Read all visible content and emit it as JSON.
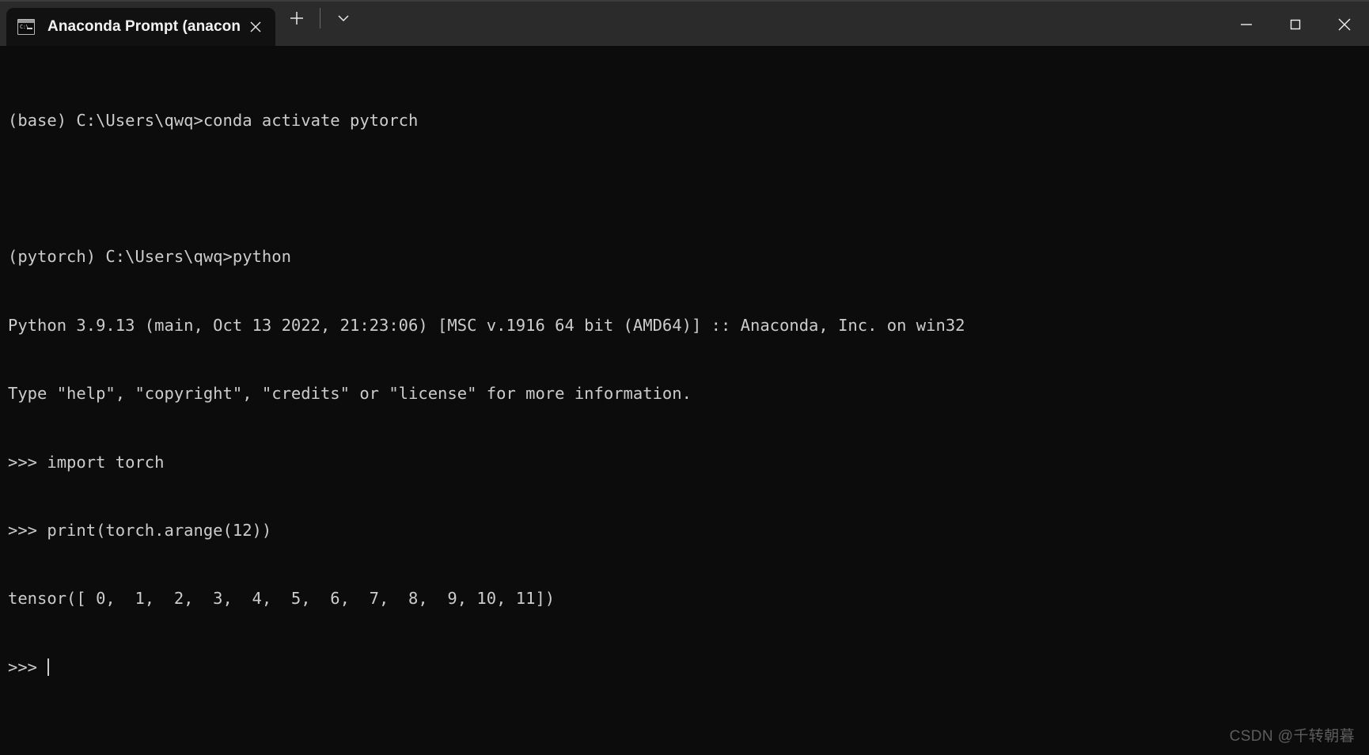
{
  "window": {
    "app": "Windows Terminal",
    "background_color": "#0c0c0c",
    "chrome_color": "#2b2b2b",
    "text_color": "#cccccc"
  },
  "titlebar": {
    "tabs": [
      {
        "label": "Anaconda Prompt (anaconda",
        "icon": "console-window-icon",
        "icon_glyph": "C:\\",
        "close_label": "✕",
        "active": true
      }
    ],
    "new_tab_label": "+",
    "dropdown_label": "⌄"
  },
  "window_controls": {
    "minimize_label": "—",
    "maximize_label": "□",
    "close_label": "✕"
  },
  "terminal": {
    "lines": [
      "(base) C:\\Users\\qwq>conda activate pytorch",
      "",
      "(pytorch) C:\\Users\\qwq>python",
      "Python 3.9.13 (main, Oct 13 2022, 21:23:06) [MSC v.1916 64 bit (AMD64)] :: Anaconda, Inc. on win32",
      "Type \"help\", \"copyright\", \"credits\" or \"license\" for more information.",
      ">>> import torch",
      ">>> print(torch.arange(12))",
      "tensor([ 0,  1,  2,  3,  4,  5,  6,  7,  8,  9, 10, 11])"
    ],
    "prompt": ">>> ",
    "cursor_visible": true
  },
  "watermark": {
    "text": "CSDN @千转朝暮"
  }
}
